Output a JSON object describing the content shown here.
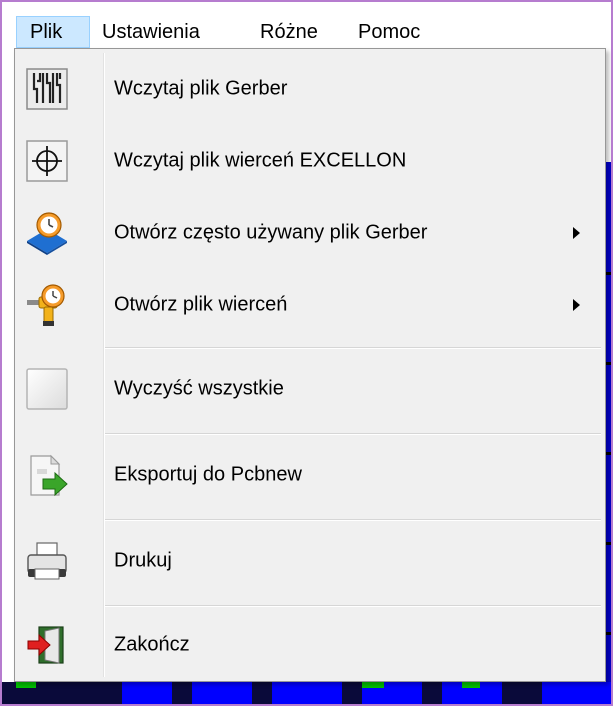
{
  "menubar": {
    "items": [
      {
        "label": "Plik",
        "active": true
      },
      {
        "label": "Ustawienia",
        "active": false
      },
      {
        "label": "Różne",
        "active": false
      },
      {
        "label": "Pomoc",
        "active": false
      }
    ]
  },
  "dropdown": {
    "items": [
      {
        "label": "Wczytaj plik Gerber",
        "icon": "gerber-file-icon",
        "submenu": false
      },
      {
        "label": "Wczytaj plik wierceń EXCELLON",
        "icon": "drill-target-icon",
        "submenu": false
      },
      {
        "label": "Otwórz często używany plik Gerber",
        "icon": "recent-gerber-icon",
        "submenu": true
      },
      {
        "label": "Otwórz plik wierceń",
        "icon": "recent-drill-icon",
        "submenu": true
      },
      {
        "label": "Wyczyść wszystkie",
        "icon": "clear-all-icon",
        "submenu": false
      },
      {
        "label": "Eksportuj do Pcbnew",
        "icon": "export-pcbnew-icon",
        "submenu": false
      },
      {
        "label": "Drukuj",
        "icon": "printer-icon",
        "submenu": false
      },
      {
        "label": "Zakończ",
        "icon": "exit-door-icon",
        "submenu": false
      }
    ]
  },
  "colors": {
    "menu_highlight": "#cce8ff",
    "menu_background": "#f0f0f0",
    "canvas_background": "#0a0a3a"
  }
}
